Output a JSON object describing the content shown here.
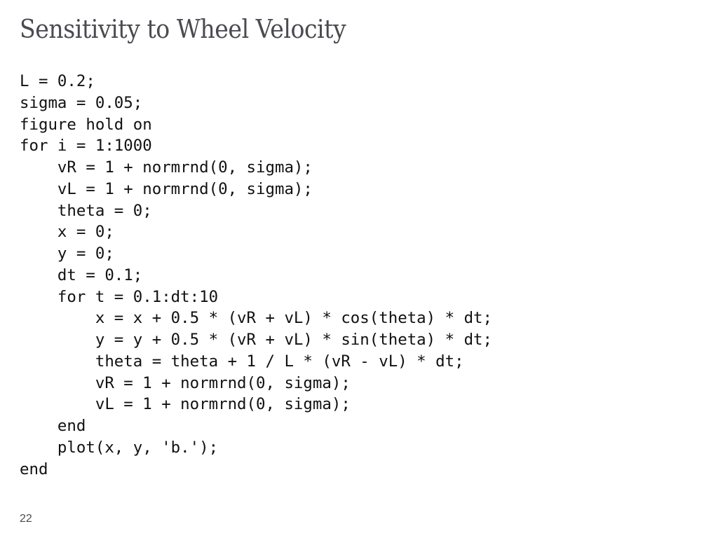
{
  "slide": {
    "title": "Sensitivity to Wheel Velocity",
    "page_number": "22",
    "code_lines": [
      "L = 0.2;",
      "sigma = 0.05;",
      "figure hold on",
      "for i = 1:1000",
      "    vR = 1 + normrnd(0, sigma);",
      "    vL = 1 + normrnd(0, sigma);",
      "    theta = 0;",
      "    x = 0;",
      "    y = 0;",
      "    dt = 0.1;",
      "    for t = 0.1:dt:10",
      "        x = x + 0.5 * (vR + vL) * cos(theta) * dt;",
      "        y = y + 0.5 * (vR + vL) * sin(theta) * dt;",
      "        theta = theta + 1 / L * (vR - vL) * dt;",
      "        vR = 1 + normrnd(0, sigma);",
      "        vL = 1 + normrnd(0, sigma);",
      "    end",
      "    plot(x, y, 'b.');",
      "end"
    ]
  }
}
